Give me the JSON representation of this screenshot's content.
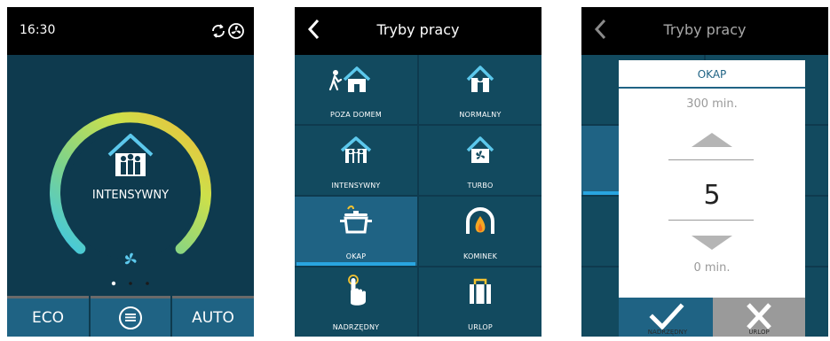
{
  "screen_home": {
    "time": "16:30",
    "mode_label": "INTENSYWNY",
    "ring_level": 0.75,
    "dots_total": 3,
    "dots_active": 1,
    "bottom": {
      "eco": "ECO",
      "auto": "AUTO"
    }
  },
  "screen_modes": {
    "title": "Tryby pracy",
    "tiles": [
      {
        "label": "POZA DOMEM",
        "icon": "walking-person-house-icon"
      },
      {
        "label": "NORMALNY",
        "icon": "person-house-icon"
      },
      {
        "label": "INTENSYWNY",
        "icon": "family-house-icon"
      },
      {
        "label": "TURBO",
        "icon": "fan-house-icon"
      },
      {
        "label": "OKAP",
        "icon": "cooking-pot-icon",
        "selected": true
      },
      {
        "label": "KOMINEK",
        "icon": "fireplace-icon"
      },
      {
        "label": "NADRZĘDNY",
        "icon": "pointing-hand-icon"
      },
      {
        "label": "URLOP",
        "icon": "suitcase-icon"
      }
    ]
  },
  "screen_timer": {
    "title": "Tryby pracy",
    "dialog": {
      "title": "OKAP",
      "max": "300 min.",
      "value": "5",
      "min": "0 min."
    },
    "under_labels": {
      "left": "NADRZĘDNY",
      "right": "URLOP"
    }
  },
  "colors": {
    "background": "#0e3a4e",
    "tile": "#124a5f",
    "accent": "#1f6384",
    "highlight": "#29a5e0"
  }
}
